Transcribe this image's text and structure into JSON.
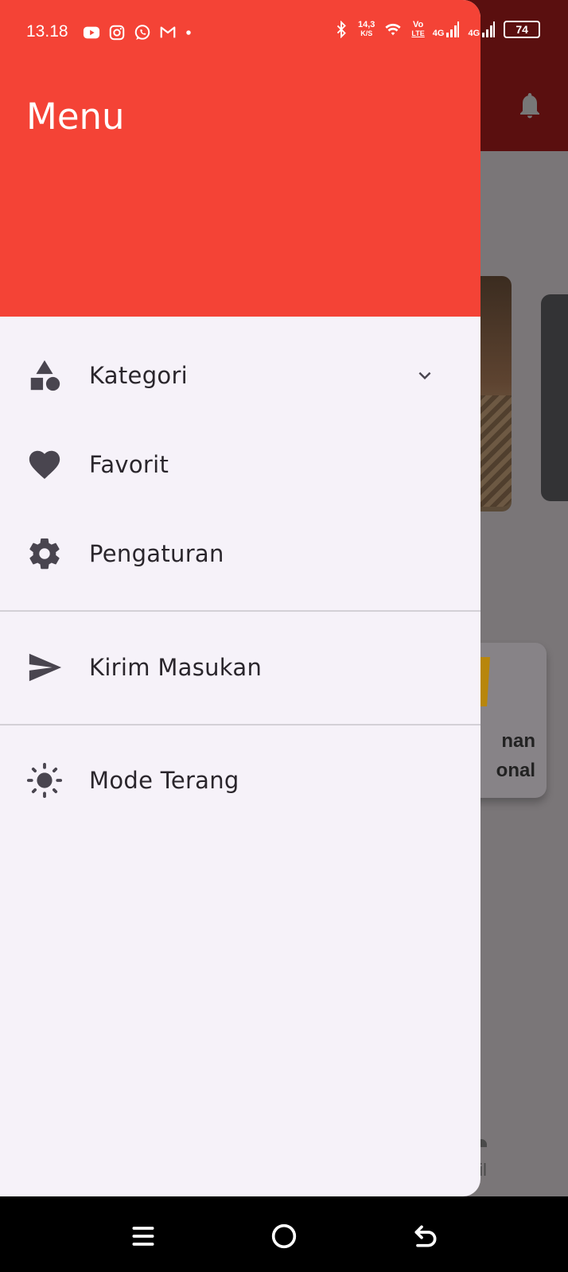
{
  "status_bar": {
    "time": "13.18",
    "net_speed_value": "14,3",
    "net_speed_unit": "K/S",
    "volte_top": "Vo",
    "volte_bottom": "LTE",
    "sim1_type": "4G",
    "sim2_type": "4G",
    "battery": "74",
    "left_icons": [
      "youtube-icon",
      "instagram-icon",
      "whatsapp-icon",
      "gmail-icon",
      "dot-icon"
    ],
    "right_icons": [
      "bluetooth-icon",
      "wifi-icon",
      "signal-icon",
      "signal-icon",
      "battery-icon"
    ]
  },
  "drawer": {
    "title": "Menu",
    "header_color": "#f44336",
    "items": [
      {
        "label": "Kategori",
        "icon": "shapes-icon",
        "expandable": true
      },
      {
        "label": "Favorit",
        "icon": "heart-icon"
      },
      {
        "label": "Pengaturan",
        "icon": "gear-icon"
      },
      {
        "label": "Kirim Masukan",
        "icon": "send-icon"
      },
      {
        "label": "Mode Terang",
        "icon": "sun-icon"
      }
    ]
  },
  "background_app": {
    "appbar_color": "#5a0f0f",
    "card_line1": "nan",
    "card_line2": "onal",
    "nav_label": "fil"
  },
  "system_nav": {
    "buttons": [
      "recents-icon",
      "home-icon",
      "back-icon"
    ]
  }
}
